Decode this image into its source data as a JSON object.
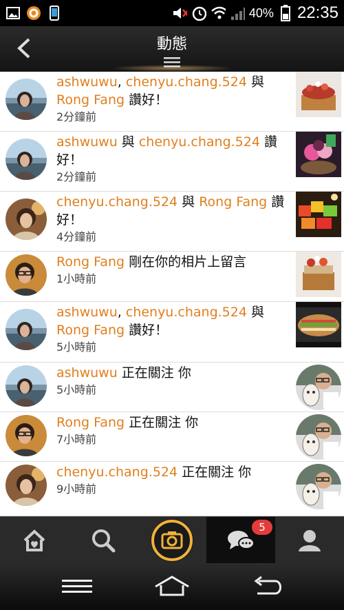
{
  "status_bar": {
    "battery_percent": "40%",
    "time": "22:35",
    "icons": [
      "gallery-icon",
      "orange-app-icon",
      "phone-icon",
      "mute-icon",
      "alarm-icon",
      "wifi-icon",
      "signal-icon",
      "battery-icon"
    ]
  },
  "header": {
    "title": "動態",
    "back_icon": "chevron-left-icon",
    "menu_icon": "menu-handle-icon"
  },
  "feed": [
    {
      "parts": [
        {
          "t": "ashwuwu",
          "n": true
        },
        {
          "t": ", ",
          "n": false
        },
        {
          "t": "chenyu.chang.524",
          "n": true
        },
        {
          "t": " 與 ",
          "n": false
        },
        {
          "t": "Rong Fang",
          "n": true
        },
        {
          "t": " 讚好！",
          "n": false
        }
      ],
      "time": "2分鐘前",
      "avatar": "a",
      "thumb": "cake1"
    },
    {
      "parts": [
        {
          "t": "ashwuwu",
          "n": true
        },
        {
          "t": " 與 ",
          "n": false
        },
        {
          "t": "chenyu.chang.524",
          "n": true
        },
        {
          "t": " 讚好！",
          "n": false
        }
      ],
      "time": "2分鐘前",
      "avatar": "a",
      "thumb": "icecream"
    },
    {
      "parts": [
        {
          "t": "chenyu.chang.524",
          "n": true
        },
        {
          "t": " 與 ",
          "n": false
        },
        {
          "t": "Rong Fang",
          "n": true
        },
        {
          "t": " 讚好！",
          "n": false
        }
      ],
      "time": "4分鐘前",
      "avatar": "c",
      "thumb": "fruit"
    },
    {
      "parts": [
        {
          "t": "Rong Fang",
          "n": true
        },
        {
          "t": " 剛在你的相片上留言",
          "n": false
        }
      ],
      "time": "1小時前",
      "avatar": "r",
      "thumb": "cake2"
    },
    {
      "parts": [
        {
          "t": "ashwuwu",
          "n": true
        },
        {
          "t": ", ",
          "n": false
        },
        {
          "t": "chenyu.chang.524",
          "n": true
        },
        {
          "t": " 與 ",
          "n": false
        },
        {
          "t": "Rong Fang",
          "n": true
        },
        {
          "t": " 讚好！",
          "n": false
        }
      ],
      "time": "5小時前",
      "avatar": "a",
      "thumb": "sandwich"
    },
    {
      "parts": [
        {
          "t": "ashwuwu",
          "n": true
        },
        {
          "t": " 正在關注 你",
          "n": false
        }
      ],
      "time": "5小時前",
      "avatar": "a",
      "thumb": "mask"
    },
    {
      "parts": [
        {
          "t": "Rong Fang",
          "n": true
        },
        {
          "t": " 正在關注 你",
          "n": false
        }
      ],
      "time": "7小時前",
      "avatar": "r",
      "thumb": "mask"
    },
    {
      "parts": [
        {
          "t": "chenyu.chang.524",
          "n": true
        },
        {
          "t": " 正在關注 你",
          "n": false
        }
      ],
      "time": "9小時前",
      "avatar": "c",
      "thumb": "mask"
    }
  ],
  "bottom_nav": {
    "items": [
      {
        "name": "home-icon"
      },
      {
        "name": "search-icon"
      },
      {
        "name": "camera-icon"
      },
      {
        "name": "activity-icon",
        "active": true,
        "badge": "5"
      },
      {
        "name": "profile-icon"
      }
    ]
  },
  "system_nav": {
    "items": [
      "menu-icon",
      "home-icon",
      "back-icon"
    ]
  },
  "colors": {
    "name_accent": "#e07f1e",
    "badge": "#e43c3c",
    "camera_ring": "#f0b23a"
  }
}
